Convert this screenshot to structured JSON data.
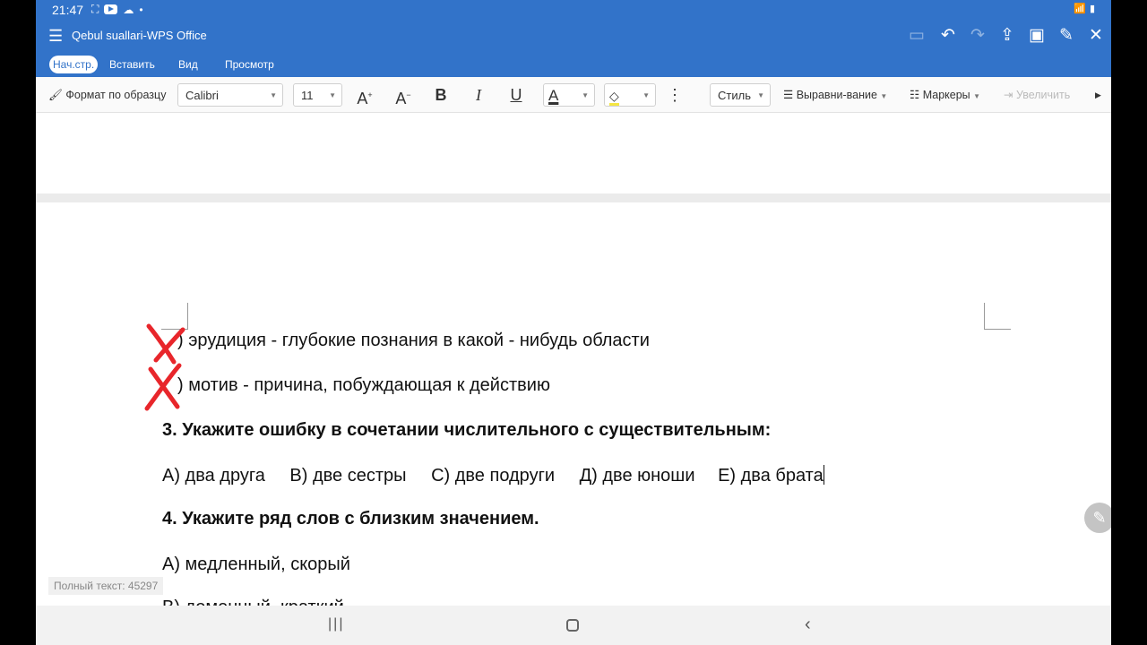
{
  "status_bar": {
    "time": "21:47"
  },
  "title_bar": {
    "title": "Qebul suallari-WPS Office",
    "icons": [
      "menu-icon",
      "save-icon",
      "undo-icon",
      "redo-icon",
      "share-icon",
      "page-mode-icon",
      "edit-icon",
      "close-icon"
    ]
  },
  "tabs": [
    "Нач.стр.",
    "Вставить",
    "Вид",
    "Просмотр"
  ],
  "toolbar": {
    "format_painter": "Формат по образцу",
    "font": "Calibri",
    "size": "11",
    "style": "Стиль",
    "align": "Выравни-вание",
    "markers": "Маркеры",
    "indent": "Увеличить"
  },
  "document": {
    "line1": ") эрудиция - глубокие познания в какой - нибудь области",
    "line2": ") мотив - причина, побуждающая к действию",
    "q3": "3. Укажите ошибку в сочетании числительного с существительным:",
    "q3_answers": [
      "А) два друга",
      "В) две сестры",
      "С) две подруги",
      "Д) две юноши",
      "Е) два брата"
    ],
    "q4": "4. Укажите ряд слов с близким значением.",
    "q4_a": "А) медленный, скорый",
    "q4_b": "В) доменный, краткий"
  },
  "word_count": "Полный текст: 45297"
}
